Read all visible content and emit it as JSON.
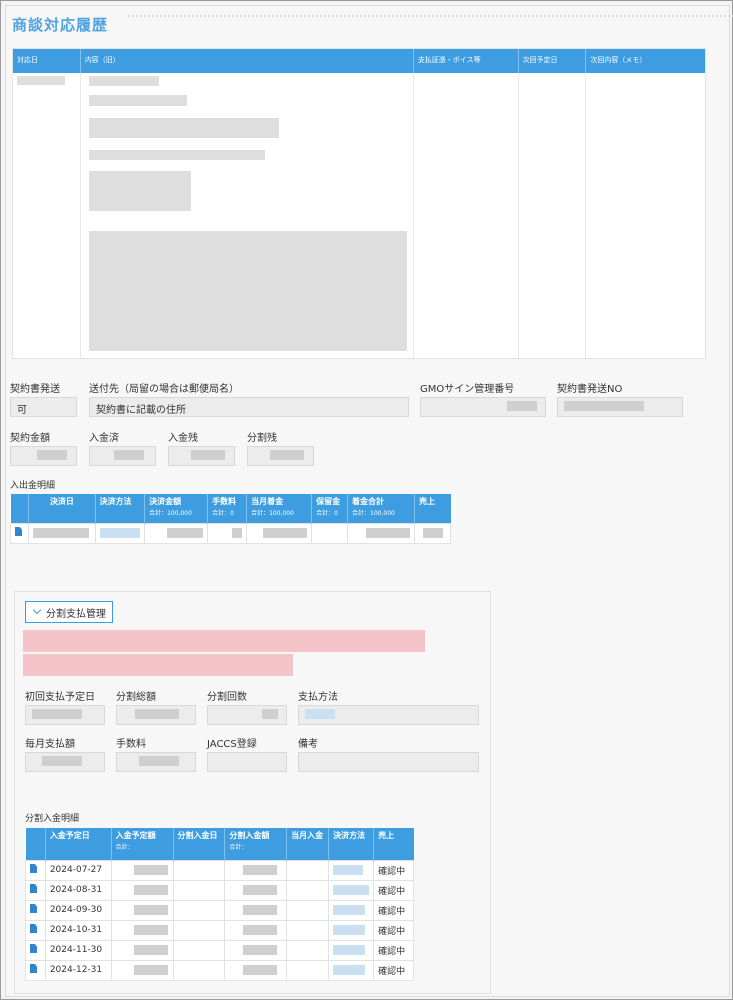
{
  "page_title": "商談対応履歴",
  "history_table": {
    "headers": [
      "対応日",
      "内容（旧）",
      "支払証憑・ボイス等",
      "次回予定日",
      "次回内容（メモ）"
    ]
  },
  "contract": {
    "send_label": "契約書発送",
    "send_value": "可",
    "dest_label": "送付先（局留の場合は郵便局名）",
    "dest_value": "契約書に記載の住所",
    "gmo_label": "GMOサイン管理番号",
    "send_no_label": "契約書発送NO",
    "amount_label": "契約金額",
    "paid_label": "入金済",
    "remain_label": "入金残",
    "split_remain_label": "分割残"
  },
  "payment_table": {
    "section_label": "入出金明細",
    "headers": [
      "決済日",
      "決済方法",
      "決済金額",
      "手数料",
      "当月着金",
      "保留金",
      "着金合計",
      "売上"
    ],
    "subtotals": [
      "",
      "",
      "合計：100,000",
      "合計：0",
      "合計：100,000",
      "合計：0",
      "合計：100,000",
      ""
    ]
  },
  "installment": {
    "toggle_label": "分割支払管理",
    "first_date_label": "初回支払予定日",
    "total_label": "分割総額",
    "count_label": "分割回数",
    "method_label": "支払方法",
    "monthly_label": "毎月支払額",
    "fee_label": "手数料",
    "jaccs_label": "JACCS登録",
    "note_label": "備考",
    "table_label": "分割入金明細",
    "headers": [
      "入金予定日",
      "入金予定額",
      "分割入金日",
      "分割入金額",
      "当月入金",
      "決済方法",
      "売上"
    ],
    "subtotals": [
      "",
      "合計：",
      "",
      "合計：",
      "",
      "",
      ""
    ],
    "rows": [
      {
        "date": "2024-07-27",
        "status": "確認中"
      },
      {
        "date": "2024-08-31",
        "status": "確認中"
      },
      {
        "date": "2024-09-30",
        "status": "確認中"
      },
      {
        "date": "2024-10-31",
        "status": "確認中"
      },
      {
        "date": "2024-11-30",
        "status": "確認中"
      },
      {
        "date": "2024-12-31",
        "status": "確認中"
      }
    ]
  },
  "colors": {
    "accent": "#3d9de0",
    "title": "#4fa3e0",
    "redacted_pink": "#f4b3b8"
  }
}
